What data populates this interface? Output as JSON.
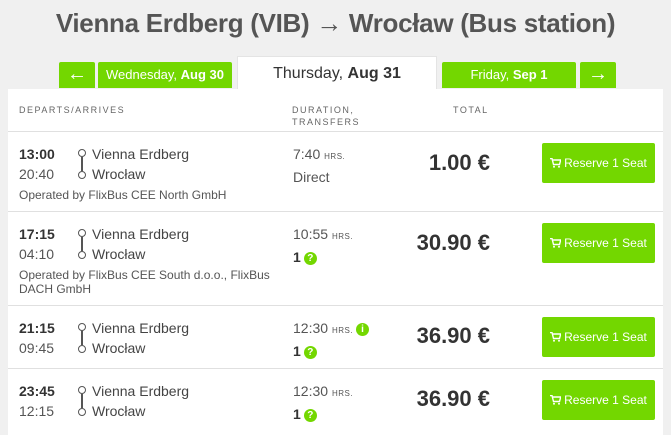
{
  "header": {
    "title": "Vienna Erdberg (VIB) → Wrocław (Bus station)"
  },
  "day_nav": {
    "prev_arrow": "←",
    "next_arrow": "→",
    "prev_day": {
      "weekday": "Wednesday, ",
      "date": "Aug 30"
    },
    "current_day": {
      "weekday": "Thursday, ",
      "date": "Aug 31"
    },
    "next_day": {
      "weekday": "Friday, ",
      "date": "Sep 1"
    }
  },
  "table": {
    "columns": {
      "departs": "DEPARTS/ARRIVES",
      "duration_1": "DURATION,",
      "duration_2": "TRANSFERS",
      "total": "TOTAL"
    },
    "hrs_label": "HRS.",
    "reserve_label": "Reserve 1 Seat",
    "rows": [
      {
        "depart": "13:00",
        "arrive": "20:40",
        "from": "Vienna Erdberg",
        "to": "Wrocław",
        "operator": "Operated by FlixBus CEE North GmbH",
        "duration": "7:40",
        "transfers": "Direct",
        "price": "1.00 €"
      },
      {
        "depart": "17:15",
        "arrive": "04:10",
        "from": "Vienna Erdberg",
        "to": "Wrocław",
        "operator": "Operated by FlixBus CEE South d.o.o., FlixBus DACH GmbH",
        "duration": "10:55",
        "transfers": "1",
        "price": "30.90 €"
      },
      {
        "depart": "21:15",
        "arrive": "09:45",
        "from": "Vienna Erdberg",
        "to": "Wrocław",
        "operator": "",
        "duration": "12:30",
        "transfers": "1",
        "price": "36.90 €"
      },
      {
        "depart": "23:45",
        "arrive": "12:15",
        "from": "Vienna Erdberg",
        "to": "Wrocław",
        "operator": "",
        "duration": "12:30",
        "transfers": "1",
        "price": "36.90 €"
      }
    ]
  },
  "colors": {
    "accent": "#73d700",
    "text": "#444444",
    "background": "#f0f0f0"
  },
  "icons": {
    "cart": "shopping-cart-icon",
    "question": "question-icon",
    "info": "info-icon"
  }
}
